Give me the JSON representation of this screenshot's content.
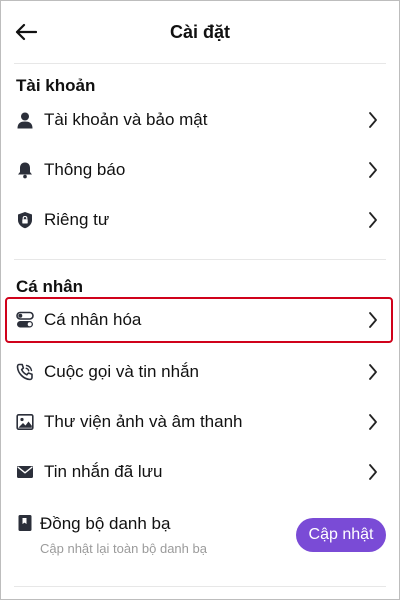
{
  "header": {
    "title": "Cài đặt"
  },
  "sections": {
    "account": {
      "title": "Tài khoản",
      "items": [
        {
          "label": "Tài khoản và bảo mật",
          "icon": "user-icon"
        },
        {
          "label": "Thông báo",
          "icon": "bell-icon"
        },
        {
          "label": "Riêng tư",
          "icon": "lock-shield-icon"
        }
      ]
    },
    "personal": {
      "title": "Cá nhân",
      "items": [
        {
          "label": "Cá nhân hóa",
          "icon": "toggle-icon",
          "highlighted": true
        },
        {
          "label": "Cuộc gọi và tin nhắn",
          "icon": "phone-icon"
        },
        {
          "label": "Thư viện ảnh và âm thanh",
          "icon": "image-icon"
        },
        {
          "label": "Tin nhắn đã lưu",
          "icon": "mail-icon"
        }
      ],
      "sync": {
        "title": "Đồng bộ danh bạ",
        "subtitle": "Cập nhật lại toàn bộ danh bạ",
        "button_label": "Cập nhật",
        "icon": "contact-book-icon"
      }
    }
  },
  "colors": {
    "accent": "#7a4bd6",
    "highlight_border": "#d0021b",
    "icon": "#2b2f3a"
  }
}
